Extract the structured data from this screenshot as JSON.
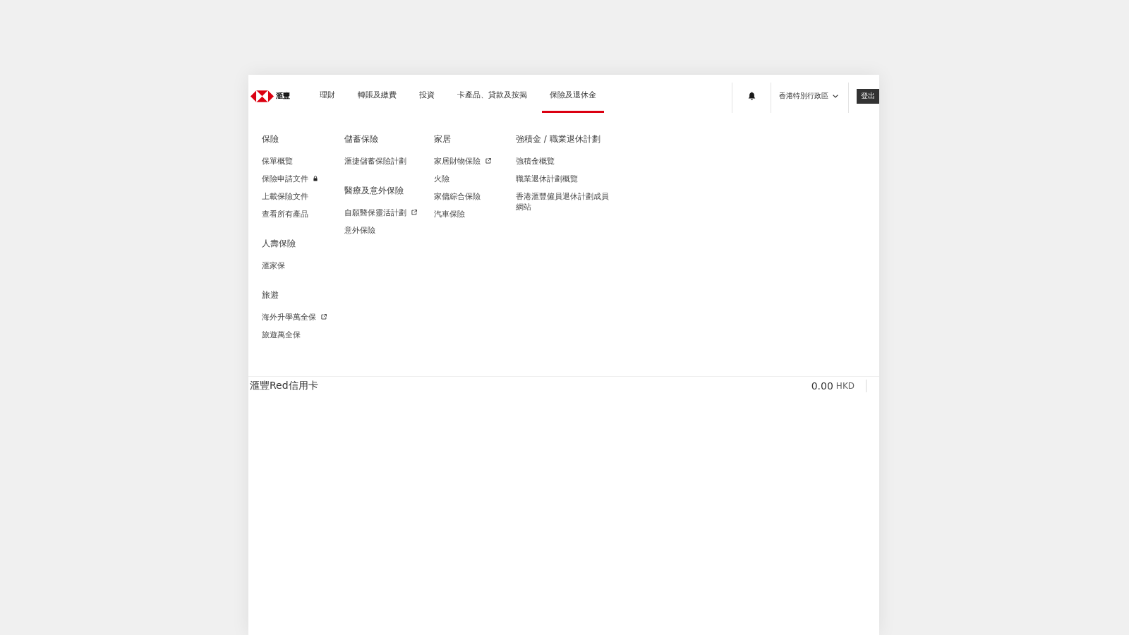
{
  "header": {
    "logo_text": "滙豐",
    "nav": [
      {
        "label": "理財",
        "selected": false
      },
      {
        "label": "轉賬及繳費",
        "selected": false
      },
      {
        "label": "投資",
        "selected": false
      },
      {
        "label": "卡產品、貸款及按揭",
        "selected": false
      },
      {
        "label": "保險及退休金",
        "selected": true
      }
    ],
    "region": "香港特別行政區",
    "logout": "登出"
  },
  "menu": {
    "columns": [
      {
        "groups": [
          {
            "heading": "保險",
            "items": [
              {
                "label": "保單概覽",
                "kind": "link"
              },
              {
                "label": "保險申請文件",
                "kind": "locked"
              },
              {
                "label": "上載保險文件",
                "kind": "link"
              },
              {
                "label": "查看所有產品",
                "kind": "link"
              }
            ]
          },
          {
            "heading": "人壽保險",
            "items": [
              {
                "label": "滙家保",
                "kind": "link"
              }
            ]
          },
          {
            "heading": "旅遊",
            "items": [
              {
                "label": "海外升學萬全保",
                "kind": "external"
              },
              {
                "label": "旅遊萬全保",
                "kind": "link"
              }
            ]
          }
        ]
      },
      {
        "groups": [
          {
            "heading": "儲蓄保險",
            "items": [
              {
                "label": "滙捷儲蓄保險計劃",
                "kind": "link"
              }
            ]
          },
          {
            "heading": "醫療及意外保險",
            "items": [
              {
                "label": "自願醫保靈活計劃",
                "kind": "external"
              },
              {
                "label": "意外保險",
                "kind": "link"
              }
            ]
          }
        ]
      },
      {
        "groups": [
          {
            "heading": "家居",
            "items": [
              {
                "label": "家居財物保險",
                "kind": "external"
              },
              {
                "label": "火險",
                "kind": "link"
              },
              {
                "label": "家傭綜合保險",
                "kind": "link"
              },
              {
                "label": "汽車保險",
                "kind": "link"
              }
            ]
          }
        ]
      },
      {
        "groups": [
          {
            "heading": "強積金 / 職業退休計劃",
            "items": [
              {
                "label": "強積金概覽",
                "kind": "link"
              },
              {
                "label": "職業退休計劃概覽",
                "kind": "link"
              },
              {
                "label": "香港滙豐僱員退休計劃成員網站",
                "kind": "link"
              }
            ]
          }
        ]
      }
    ]
  },
  "account_row": {
    "name": "滙豐Red信用卡",
    "amount": "0.00",
    "currency": "HKD"
  }
}
